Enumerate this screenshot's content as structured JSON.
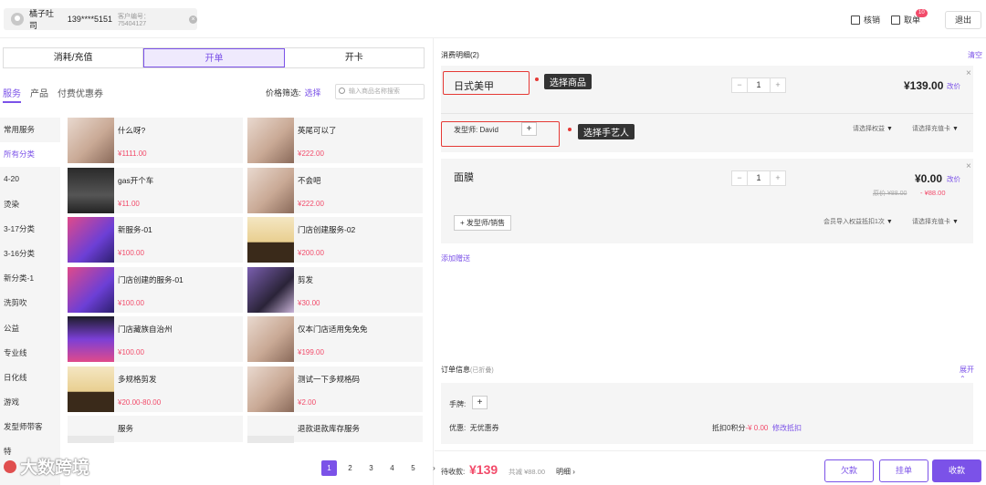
{
  "header": {
    "customer_name": "橘子吐司",
    "customer_phone": "139****5151",
    "customer_no": "客户编号：75404127",
    "verify_label": "核销",
    "pickup_label": "取单",
    "pickup_badge": "10",
    "logout_label": "退出"
  },
  "left": {
    "tabs": [
      "消耗/充值",
      "开单",
      "开卡"
    ],
    "subtabs": [
      "服务",
      "产品",
      "付费优惠券"
    ],
    "price_filter_label": "价格筛选:",
    "price_filter_select": "选择",
    "search_placeholder": "输入商品名称搜索",
    "categories": [
      "常用服务",
      "所有分类",
      "4-20",
      "烫染",
      "3-17分类",
      "3-16分类",
      "新分类-1",
      "洗剪吹",
      "公益",
      "专业线",
      "日化线",
      "游戏",
      "发型师带客",
      "特"
    ],
    "products": [
      {
        "name": "什么呀?",
        "price": "¥1111.00",
        "img": "portrait"
      },
      {
        "name": "英尾可以了",
        "price": "¥222.00",
        "img": "portrait"
      },
      {
        "name": "gas开个车",
        "price": "¥11.00",
        "img": "store"
      },
      {
        "name": "不会吧",
        "price": "¥222.00",
        "img": "portrait"
      },
      {
        "name": "新服务-01",
        "price": "¥100.00",
        "img": "poster"
      },
      {
        "name": "门店创建服务-02",
        "price": "¥200.00",
        "img": "plus"
      },
      {
        "name": "门店创建的服务-01",
        "price": "¥100.00",
        "img": "poster"
      },
      {
        "name": "剪发",
        "price": "¥30.00",
        "img": "girl"
      },
      {
        "name": "门店藏族自治州",
        "price": "¥100.00",
        "img": "phone"
      },
      {
        "name": "仅本门店适用免免免",
        "price": "¥199.00",
        "img": "portrait"
      },
      {
        "name": "多规格剪发",
        "price": "¥20.00-80.00",
        "img": "plus"
      },
      {
        "name": "测试一下多规格码",
        "price": "¥2.00",
        "img": "portrait"
      },
      {
        "name": "服务",
        "price": "",
        "img": "blank"
      },
      {
        "name": "退款退款库存服务",
        "price": "",
        "img": "blank"
      }
    ],
    "pages": [
      "1",
      "2",
      "3",
      "4",
      "5"
    ],
    "current_page": "1"
  },
  "right": {
    "title": "消费明细(2)",
    "clear_label": "清空",
    "items": [
      {
        "name": "日式美甲",
        "qty": "1",
        "price": "¥139.00",
        "change": "改价",
        "staff": "发型师: David",
        "rights": "请选择权益",
        "card": "请选择充值卡"
      },
      {
        "name": "面膜",
        "qty": "1",
        "price": "¥0.00",
        "change": "改价",
        "orig": "原价 ¥88.00",
        "discount": "- ¥88.00",
        "staff_btn": "+ 发型师/销售",
        "rights": "会员导入权益抵扣1次",
        "card": "请选择充值卡"
      }
    ],
    "annotation_product": "选择商品",
    "annotation_staff": "选择手艺人",
    "add_gift": "添加赠送",
    "order_info_title": "订单信息",
    "order_info_sub": "(已折叠)",
    "expand_label": "展开",
    "hand_label": "手牌:",
    "coupon_label": "优惠:",
    "coupon_value": "无优惠券",
    "points_label": "抵扣0积分",
    "points_value": "-¥ 0.00",
    "points_edit": "修改抵扣",
    "pending_label": "待收款:",
    "pending_amount": "¥139",
    "reduced": "共减 ¥88.00",
    "detail": "明细",
    "btn_owe": "欠款",
    "btn_hold": "挂单",
    "btn_pay": "收款"
  },
  "watermark": "大数跨境",
  "colors": {
    "accent": "#7b52e8",
    "price": "#f24b6a",
    "annotation": "#e53935"
  }
}
